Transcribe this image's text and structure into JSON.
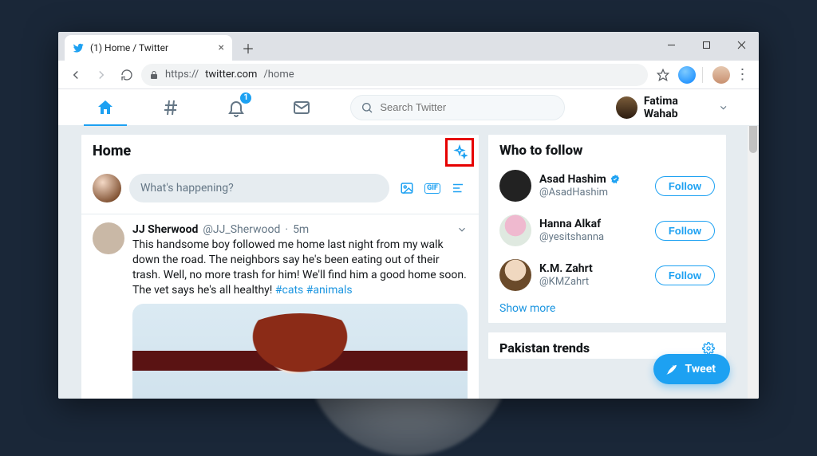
{
  "browser": {
    "tab_title": "(1) Home / Twitter",
    "url_host": "https://",
    "url_domain": "twitter.com",
    "url_path": "/home"
  },
  "nav": {
    "notification_badge": "1",
    "search_placeholder": "Search Twitter",
    "account_name": "Fatima Wahab"
  },
  "timeline": {
    "header": "Home",
    "compose_placeholder": "What's happening?",
    "tweet": {
      "display_name": "JJ Sherwood",
      "handle": "@JJ_Sherwood",
      "time_sep": " · ",
      "time": "5m",
      "body_text": "This handsome boy followed me home last night from my walk down the road. The neighbors say he's been eating out of their trash.  Well, no more trash for him!  We'll find him a good home soon. The vet says he's all healthy!",
      "hashtags": "#cats #animals"
    }
  },
  "sidebar": {
    "wtf_title": "Who to follow",
    "users": [
      {
        "name": "Asad Hashim",
        "handle": "@AsadHashim",
        "verified": true
      },
      {
        "name": "Hanna Alkaf",
        "handle": "@yesitshanna",
        "verified": false
      },
      {
        "name": "K.M. Zahrt",
        "handle": "@KMZahrt",
        "verified": false
      }
    ],
    "follow_label": "Follow",
    "show_more": "Show more",
    "trends_title": "Pakistan trends"
  },
  "fab": {
    "label": "Tweet"
  }
}
